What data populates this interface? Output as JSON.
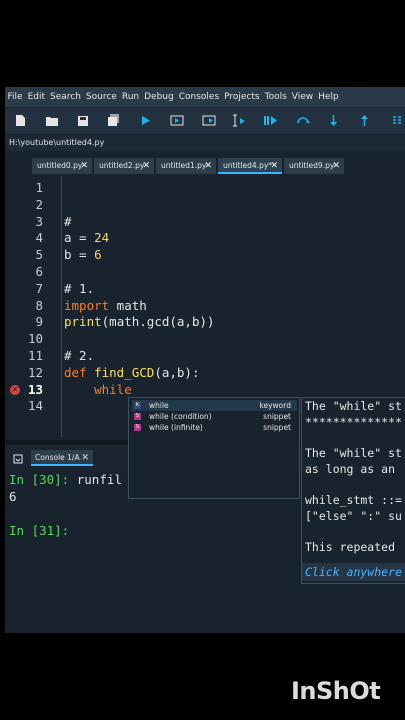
{
  "menu": [
    "File",
    "Edit",
    "Search",
    "Source",
    "Run",
    "Debug",
    "Consoles",
    "Projects",
    "Tools",
    "View",
    "Help"
  ],
  "toolbar_icons": [
    "new-file-icon",
    "open-file-icon",
    "save-icon",
    "save-all-icon",
    "run-icon",
    "run-cell-icon",
    "run-cell-advance-icon",
    "run-selection-icon",
    "debug-icon",
    "step-icon",
    "step-into-icon",
    "step-return-icon"
  ],
  "path": "H:\\youtube\\untitled4.py",
  "tabs": [
    {
      "label": "untitled0.py",
      "active": false
    },
    {
      "label": "untitled2.py",
      "active": false
    },
    {
      "label": "untitled1.py",
      "active": false
    },
    {
      "label": "untitled4.py*",
      "active": true
    },
    {
      "label": "untitled9.py",
      "active": false
    }
  ],
  "editor": {
    "line_numbers": [
      "1",
      "2",
      "3",
      "4",
      "5",
      "6",
      "7",
      "8",
      "9",
      "10",
      "11",
      "12",
      "13",
      "14"
    ],
    "error_line": "13",
    "lines": [
      "",
      "",
      "#",
      "a = 24",
      "b = 6",
      "",
      "# 1.",
      "import math",
      "print(math.gcd(a,b))",
      "",
      "# 2.",
      "def find_GCD(a,b):",
      "    while",
      ""
    ]
  },
  "console": {
    "tab_label": "Console 1/A",
    "lines": [
      {
        "prompt": "In [30]:",
        "text": " runfil"
      },
      {
        "prompt": "",
        "text": "6"
      },
      {
        "prompt": "",
        "text": ""
      },
      {
        "prompt": "In [31]:",
        "text": ""
      }
    ]
  },
  "completion": [
    {
      "name": "while",
      "type": "keyword",
      "icon": "keyword-icon",
      "selected": true
    },
    {
      "name": "while (condition)",
      "type": "snippet",
      "icon": "snippet-icon",
      "selected": false
    },
    {
      "name": "while (infinite)",
      "type": "snippet",
      "icon": "snippet-icon",
      "selected": false
    }
  ],
  "doc": {
    "lines": [
      "The \"while\" st",
      "**************",
      "",
      "The \"while\" st",
      "as long as an",
      "",
      "while_stmt ::=",
      "[\"else\" \":\" su",
      "",
      "This repeated"
    ],
    "footer": "Click anywhere"
  },
  "watermark": "InShOt"
}
